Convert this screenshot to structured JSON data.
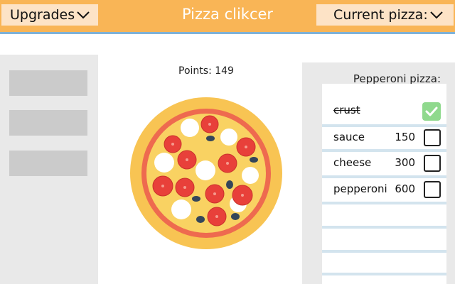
{
  "header": {
    "title": "Pizza clikcer",
    "upgrades_label": "Upgrades",
    "current_pizza_label": "Current pizza:",
    "accent_color": "#f9b556"
  },
  "game": {
    "points_text": "Points: 149"
  },
  "upgrades_panel": {
    "slots": 3
  },
  "recipe": {
    "title": "Pepperoni pizza:",
    "ingredients": [
      {
        "name": "crust",
        "cost": "",
        "completed": true
      },
      {
        "name": "sauce",
        "cost": "150",
        "completed": false
      },
      {
        "name": "cheese",
        "cost": "300",
        "completed": false
      },
      {
        "name": "pepperoni",
        "cost": "600",
        "completed": false
      }
    ],
    "done_color": "#8fd98d"
  },
  "icons": {
    "dropdown": "chevron-down-icon",
    "check": "check-icon",
    "pizza": "pizza-icon"
  }
}
